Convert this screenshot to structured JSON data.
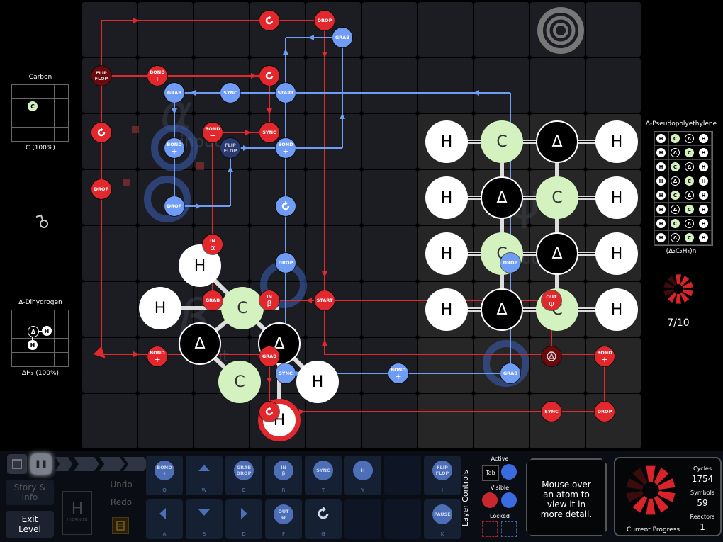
{
  "colors": {
    "red": "#e2272d",
    "blue": "#6f9cf4",
    "carbon": "#d3f2c0",
    "delta": "#000000",
    "hydrogen": "#ffffff"
  },
  "input_alpha": {
    "title": "Carbon",
    "atoms": [
      {
        "symbol": "C"
      }
    ],
    "footer": "C (100%)"
  },
  "input_beta": {
    "title": "Δ-Dihydrogen",
    "atoms": [
      {
        "symbol": "Δ"
      },
      {
        "symbol": "H"
      },
      {
        "symbol": "H"
      }
    ],
    "footer": "ΔH₂ (100%)"
  },
  "output": {
    "title": "Δ-Pseudopolyethylene",
    "footer": "(Δ₂C₂H₄)n",
    "progress_text": "7/10",
    "grid": [
      [
        "H",
        "C",
        "Δ",
        "H"
      ],
      [
        "H",
        "Δ",
        "C",
        "H"
      ],
      [
        "H",
        "C",
        "Δ",
        "H"
      ],
      [
        "H",
        "Δ",
        "C",
        "H"
      ],
      [
        "H",
        "C",
        "Δ",
        "H"
      ],
      [
        "H",
        "Δ",
        "C",
        "H"
      ],
      [
        "H",
        "C",
        "Δ",
        "H"
      ],
      [
        "H",
        "Δ",
        "C",
        "H"
      ]
    ]
  },
  "board": {
    "labels": {
      "input_alpha": "α",
      "input_beta": "β",
      "output_psi": "ψ",
      "input_word": "input",
      "output_word": "outp"
    },
    "atoms": [
      {
        "s": "H",
        "role": "big-H"
      },
      {
        "s": "C",
        "role": "big-C"
      },
      {
        "s": "Δ",
        "role": "big-Δ"
      }
    ],
    "red_nodes": [
      {
        "label": "DROP"
      },
      {
        "label": "BOND",
        "sub": "+"
      },
      {
        "label": "FLIP",
        "sub": "FLOP"
      },
      {
        "label": "BOND",
        "sub": "−"
      },
      {
        "label": "SYNC"
      },
      {
        "label": "IN",
        "sub": "α"
      },
      {
        "label": "GRAB"
      },
      {
        "label": "IN",
        "sub": "β"
      },
      {
        "label": "START"
      },
      {
        "label": "OUT",
        "sub": "ψ"
      },
      {
        "label": "BOND",
        "sub": "+"
      },
      {
        "label": "SYNC"
      },
      {
        "label": "DROP"
      }
    ],
    "blue_nodes": [
      {
        "label": "GRAB"
      },
      {
        "label": "SYNC"
      },
      {
        "label": "START"
      },
      {
        "label": "BOND",
        "sub": "+"
      },
      {
        "label": "FLIP",
        "sub": "FLOP"
      },
      {
        "label": "DROP"
      },
      {
        "label": "SYNC"
      },
      {
        "label": "BOND",
        "sub": "+"
      }
    ]
  },
  "controls": {
    "story_info": "Story & Info",
    "exit_level": "Exit Level",
    "undo": "Undo",
    "redo": "Redo",
    "hydrogen_card_symbol": "H",
    "hydrogen_card_name": "HYDROGEN"
  },
  "instructions": {
    "top": [
      {
        "label": "BOND",
        "sub": "+",
        "key": "Q"
      },
      {
        "icon": "up-arrow",
        "key": "W"
      },
      {
        "label": "GRAB",
        "sub": "DROP",
        "key": "E"
      },
      {
        "label": "IN",
        "sub": "β",
        "key": "R"
      },
      {
        "label": "SYNC",
        "key": "T"
      },
      {
        "label": "H",
        "key": "Y"
      },
      {
        "label": "FLIP",
        "sub": "FLOP",
        "key": "I"
      }
    ],
    "bottom": [
      {
        "icon": "left-arrow",
        "key": "A"
      },
      {
        "icon": "down-arrow",
        "key": "S"
      },
      {
        "icon": "right-arrow",
        "key": "D"
      },
      {
        "label": "OUT",
        "sub": "ω",
        "key": "F"
      },
      {
        "icon": "rotate",
        "key": "G"
      },
      {
        "label": "PAUSE",
        "key": "K"
      }
    ]
  },
  "layer_controls": {
    "title": "Layer Controls",
    "active": "Active",
    "tab": "Tab",
    "visible": "Visible",
    "locked": "Locked"
  },
  "info_box": {
    "text": "Mouse over an atom to view it in more detail."
  },
  "stats": {
    "cycles_label": "Cycles",
    "cycles": "1754",
    "symbols_label": "Symbols",
    "symbols": "59",
    "reactors_label": "Reactors",
    "reactors": "1",
    "progress_label": "Current Progress"
  }
}
